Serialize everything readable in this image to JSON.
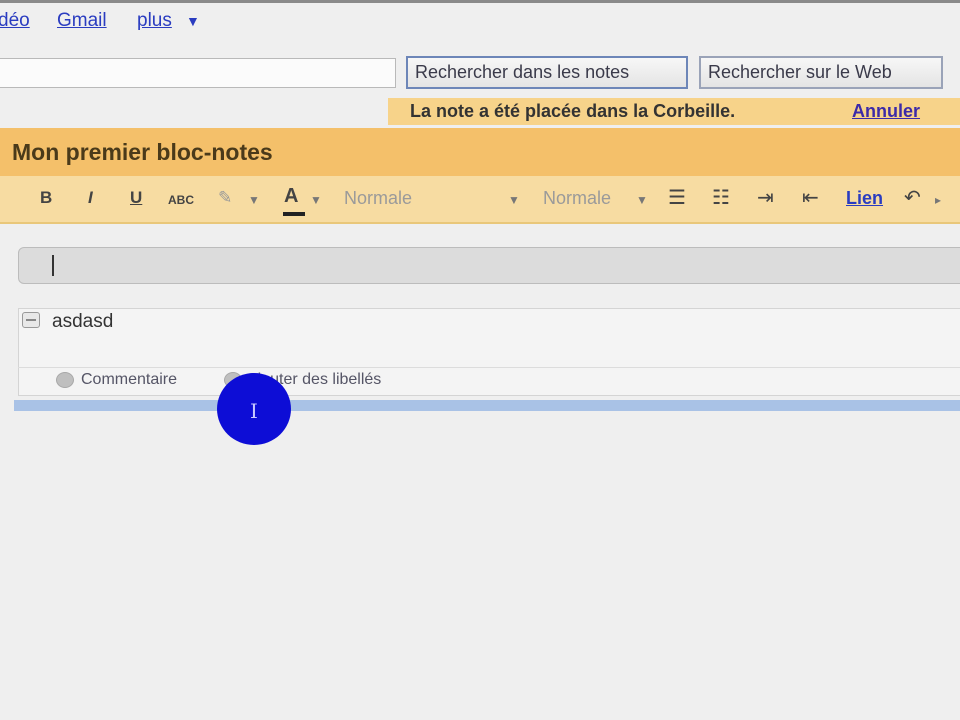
{
  "topnav": {
    "items": [
      "déo",
      "Gmail",
      "plus"
    ],
    "caret": "▼"
  },
  "search": {
    "value": "",
    "btn_notes": "Rechercher dans les notes",
    "btn_web": "Rechercher sur le Web"
  },
  "notification": {
    "message": "La note a été placée dans la Corbeille.",
    "undo": "Annuler"
  },
  "notebook": {
    "title": "Mon premier bloc-notes"
  },
  "toolbar": {
    "bold": "B",
    "italic": "I",
    "underline": "U",
    "strike": "ABC",
    "font": "Normale",
    "size": "Normale",
    "link": "Lien",
    "icons": [
      "bold-icon",
      "italic-icon",
      "underline-icon",
      "strikethrough-icon",
      "highlight-icon",
      "text-color-icon",
      "bullet-list-icon",
      "numbered-list-icon",
      "indent-icon",
      "outdent-icon",
      "undo-icon"
    ]
  },
  "note": {
    "text": "asdasd",
    "comment": "Commentaire",
    "labels": "Ajouter des libellés"
  }
}
